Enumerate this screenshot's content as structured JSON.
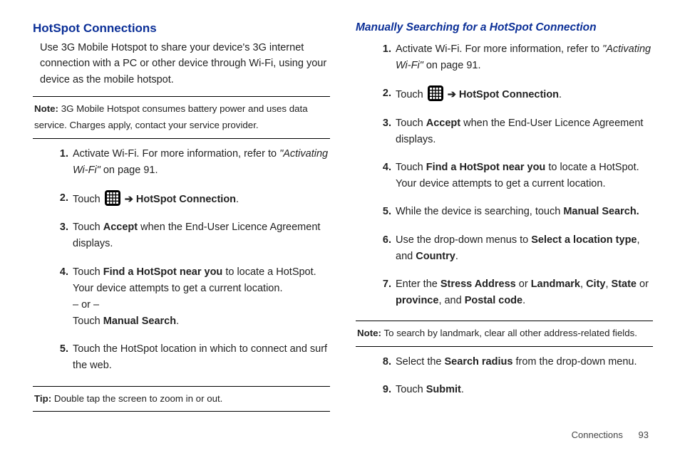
{
  "left": {
    "heading": "HotSpot Connections",
    "intro": "Use 3G Mobile Hotspot to share your device's 3G internet connection with a PC or other device through Wi-Fi, using your device as the mobile hotspot.",
    "note_label": "Note:",
    "note_text": "3G Mobile Hotspot consumes battery power and uses data service. Charges apply, contact your service provider.",
    "steps": {
      "s1_a": "Activate Wi-Fi. For more information, refer to ",
      "s1_ref": "\"Activating Wi-Fi\"",
      "s1_b": "  on page 91.",
      "s2_a": "Touch ",
      "s2_arrow": "➔",
      "s2_b": "HotSpot Connection",
      "s2_c": ".",
      "s3_a": "Touch ",
      "s3_b": "Accept",
      "s3_c": " when the End-User Licence Agreement displays.",
      "s4_a": "Touch ",
      "s4_b": "Find a HotSpot near you",
      "s4_c": " to locate a HotSpot. Your device attempts to get a current location.",
      "s4_or": "– or –",
      "s4_d": "Touch ",
      "s4_e": "Manual Search",
      "s4_f": ".",
      "s5": "Touch the HotSpot location in which to connect and surf the web."
    },
    "tip_label": "Tip:",
    "tip_text": "Double tap the screen to zoom in or out."
  },
  "right": {
    "heading": "Manually Searching for a HotSpot Connection",
    "steps": {
      "s1_a": "Activate Wi-Fi. For more information, refer to ",
      "s1_ref": "\"Activating Wi-Fi\"",
      "s1_b": "  on page 91.",
      "s2_a": "Touch ",
      "s2_arrow": "➔",
      "s2_b": "HotSpot Connection",
      "s2_c": ".",
      "s3_a": "Touch ",
      "s3_b": "Accept",
      "s3_c": " when the End-User Licence Agreement displays.",
      "s4_a": "Touch ",
      "s4_b": "Find a HotSpot near you",
      "s4_c": " to locate a HotSpot. Your device attempts to get a current location.",
      "s5_a": "While the device is searching, touch ",
      "s5_b": "Manual Search.",
      "s6_a": "Use the drop-down menus to ",
      "s6_b": "Select a location type",
      "s6_c": ", and ",
      "s6_d": "Country",
      "s6_e": ".",
      "s7_a": "Enter the ",
      "s7_b": "Stress Address",
      "s7_c": " or ",
      "s7_d": "Landmark",
      "s7_e": ", ",
      "s7_f": "City",
      "s7_g": ", ",
      "s7_h": "State",
      "s7_i": " or ",
      "s7_j": "province",
      "s7_k": ", and ",
      "s7_l": "Postal code",
      "s7_m": "."
    },
    "note_label": "Note:",
    "note_text": "To search by landmark, clear all other address-related fields.",
    "steps2": {
      "s8_a": "Select the ",
      "s8_b": "Search radius",
      "s8_c": " from the drop-down menu.",
      "s9_a": "Touch ",
      "s9_b": "Submit",
      "s9_c": "."
    }
  },
  "footer": {
    "section": "Connections",
    "page": "93"
  },
  "nums": {
    "n1": "1.",
    "n2": "2.",
    "n3": "3.",
    "n4": "4.",
    "n5": "5.",
    "n6": "6.",
    "n7": "7.",
    "n8": "8.",
    "n9": "9."
  }
}
